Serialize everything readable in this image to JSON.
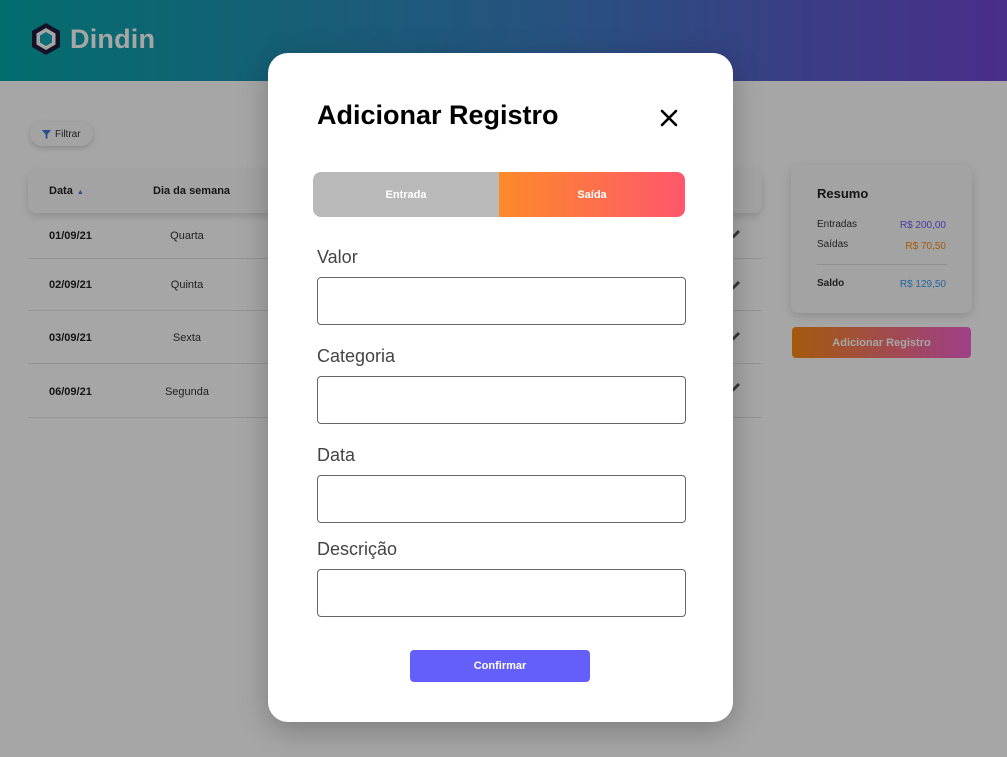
{
  "app": {
    "name": "Dindin"
  },
  "filter": {
    "label": "Filtrar"
  },
  "table": {
    "headers": {
      "date": "Data",
      "weekday": "Dia da semana"
    },
    "rows": [
      {
        "date": "01/09/21",
        "weekday": "Quarta"
      },
      {
        "date": "02/09/21",
        "weekday": "Quinta"
      },
      {
        "date": "03/09/21",
        "weekday": "Sexta"
      },
      {
        "date": "06/09/21",
        "weekday": "Segunda"
      }
    ]
  },
  "summary": {
    "title": "Resumo",
    "income_label": "Entradas",
    "income_value": "R$ 200,00",
    "expense_label": "Saídas",
    "expense_value": "R$ 70,50",
    "balance_label": "Saldo",
    "balance_value": "R$ 129,50"
  },
  "add_record_button": "Adicionar Registro",
  "modal": {
    "title": "Adicionar Registro",
    "toggle": {
      "income": "Entrada",
      "expense": "Saída",
      "selected": "Saída"
    },
    "fields": {
      "valor": {
        "label": "Valor",
        "value": ""
      },
      "categoria": {
        "label": "Categoria",
        "value": ""
      },
      "data": {
        "label": "Data",
        "value": ""
      },
      "descricao": {
        "label": "Descrição",
        "value": ""
      }
    },
    "confirm": "Confirmar"
  },
  "colors": {
    "primary": "#645ffb",
    "income": "#645ffb",
    "expense": "#fa8c10",
    "balance": "#3a9ff1"
  }
}
